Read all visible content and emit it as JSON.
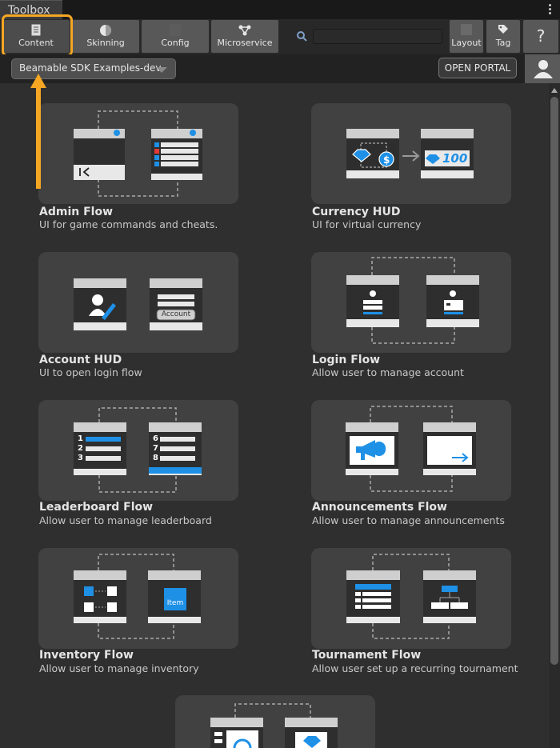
{
  "window": {
    "title": "Toolbox"
  },
  "toolbar": {
    "buttons": [
      {
        "label": "Content",
        "icon": "document-icon"
      },
      {
        "label": "Skinning",
        "icon": "palette-icon"
      },
      {
        "label": "Config",
        "icon": "config-icon"
      },
      {
        "label": "Microservice",
        "icon": "network-icon"
      }
    ],
    "search": {
      "placeholder": ""
    },
    "layout_label": "Layout",
    "tag_label": "Tag",
    "help_label": "?"
  },
  "realm": {
    "selected": "Beamable SDK Examples-dev",
    "open_portal_label": "OPEN PORTAL"
  },
  "cards": [
    {
      "title": "Admin Flow",
      "desc": "UI for game commands and cheats."
    },
    {
      "title": "Currency HUD",
      "desc": "UI for virtual currency",
      "value_label": "100"
    },
    {
      "title": "Account HUD",
      "desc": "UI to open login flow",
      "button_label": "Account"
    },
    {
      "title": "Login Flow",
      "desc": "Allow user to manage account"
    },
    {
      "title": "Leaderboard Flow",
      "desc": "Allow user to manage leaderboard",
      "ranks_left": [
        "1",
        "2",
        "3"
      ],
      "ranks_right": [
        "6",
        "7",
        "8"
      ]
    },
    {
      "title": "Announcements Flow",
      "desc": "Allow user to manage announcements"
    },
    {
      "title": "Inventory Flow",
      "desc": "Allow user to manage inventory",
      "item_label": "Item"
    },
    {
      "title": "Tournament Flow",
      "desc": "Allow user set up a recurring tournament"
    }
  ],
  "colors": {
    "accent_blue": "#1e90e6",
    "highlight_orange": "#f5a623"
  }
}
